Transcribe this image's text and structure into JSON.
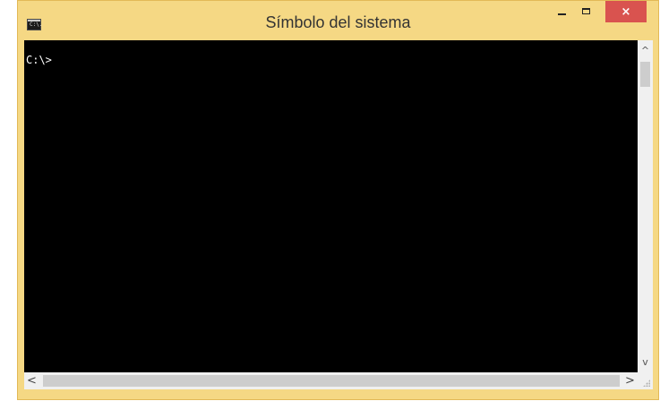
{
  "window": {
    "title": "Símbolo del sistema",
    "app_icon_text": "C:\\.",
    "colors": {
      "frame": "#f5d884",
      "close_button": "#d9534f",
      "console_background": "#000000",
      "console_text": "#ffffff"
    },
    "controls": {
      "minimize_icon": "minimize-icon",
      "maximize_icon": "maximize-icon",
      "close_icon": "close-icon",
      "close_glyph": "×"
    }
  },
  "console": {
    "prompt": "C:\\>"
  },
  "scrollbars": {
    "vertical": {
      "up_icon": "chevron-up-icon",
      "down_icon": "chevron-down-icon",
      "up_glyph": "^",
      "down_glyph": "v"
    },
    "horizontal": {
      "left_icon": "chevron-left-icon",
      "right_icon": "chevron-right-icon",
      "left_glyph": "<",
      "right_glyph": ">"
    }
  }
}
